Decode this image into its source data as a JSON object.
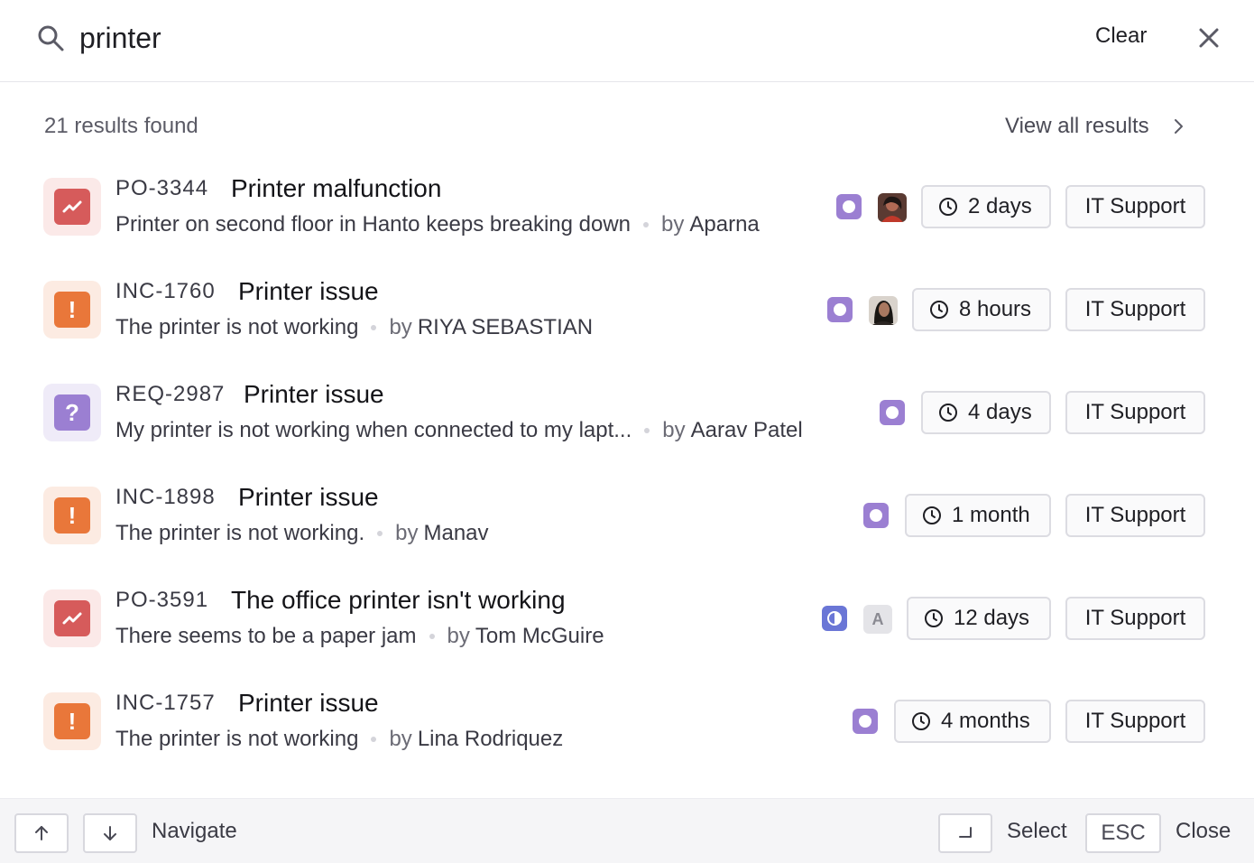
{
  "search": {
    "query": "printer",
    "clear_label": "Clear"
  },
  "results": {
    "count_label": "21 results found",
    "view_all_label": "View all results"
  },
  "items": [
    {
      "type": "problem",
      "id": "PO-3344",
      "title": "Printer malfunction",
      "description": "Printer on second floor in Hanto keeps breaking down",
      "by": "by",
      "author": "Aparna",
      "status": "in-progress",
      "assignee": "photo",
      "time": "2 days",
      "team": "IT Support"
    },
    {
      "type": "incident",
      "id": "INC-1760",
      "title": "Printer issue",
      "description": "The printer is not working",
      "by": "by",
      "author": "RIYA SEBASTIAN",
      "status": "in-progress",
      "assignee": "photo",
      "time": "8 hours",
      "team": "IT Support"
    },
    {
      "type": "request",
      "id": "REQ-2987",
      "title": "Printer issue",
      "description": "My printer is not working when connected to my lapt...",
      "by": "by",
      "author": "Aarav Patel",
      "status": "in-progress",
      "time": "4 days",
      "team": "IT Support"
    },
    {
      "type": "incident",
      "id": "INC-1898",
      "title": "Printer issue",
      "description": "The printer is not working.",
      "by": "by",
      "author": "Manav",
      "status": "in-progress",
      "time": "1 month",
      "team": "IT Support"
    },
    {
      "type": "problem",
      "id": "PO-3591",
      "title": "The office printer isn't working",
      "description": "There seems to be a paper jam",
      "by": "by",
      "author": "Tom McGuire",
      "status": "half",
      "assignee_initial": "A",
      "time": "12 days",
      "team": "IT Support"
    },
    {
      "type": "incident",
      "id": "INC-1757",
      "title": "Printer issue",
      "description": "The printer is not working",
      "by": "by",
      "author": "Lina Rodriquez",
      "status": "in-progress",
      "time": "4 months",
      "team": "IT Support"
    }
  ],
  "footer": {
    "navigate_label": "Navigate",
    "select_label": "Select",
    "esc_key": "ESC",
    "close_label": "Close"
  },
  "icons": {
    "type_problem": "trend-icon",
    "type_incident": "exclamation-icon",
    "type_request": "question-icon",
    "time": "clock-icon"
  },
  "colors": {
    "problem": "#d65b5b",
    "incident": "#e9773a",
    "request": "#9b7fd2",
    "status_purple": "#9b7fd2",
    "status_blue": "#6a76d6"
  }
}
